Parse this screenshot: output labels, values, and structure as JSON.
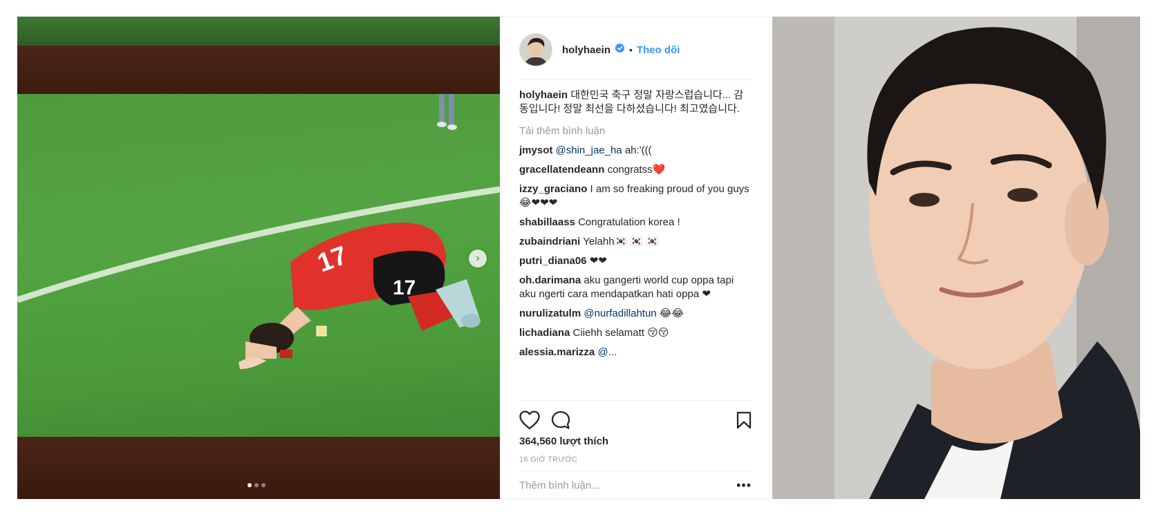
{
  "post": {
    "username": "holyhaein",
    "follow_label": "Theo dõi",
    "bullet": "•",
    "caption_user": "holyhaein",
    "caption_text": "대한민국 축구 정말 자랑스럽습니다... 감동입니다! 정말 최선을 다하셨습니다! 최고였습니다.",
    "load_more": "Tải thêm bình luận",
    "comments": [
      {
        "user": "jmysot",
        "mention": "@shin_jae_ha",
        "text": "ah:'((("
      },
      {
        "user": "gracellatendeann",
        "mention": "",
        "text": "congratss❤️"
      },
      {
        "user": "izzy_graciano",
        "mention": "",
        "text": "I am so freaking proud of you guys 😂❤❤❤"
      },
      {
        "user": "shabillaass",
        "mention": "",
        "text": "Congratulation korea !"
      },
      {
        "user": "zubaindriani",
        "mention": "",
        "text": "Yelahh🇰🇷 🇰🇷 🇰🇷"
      },
      {
        "user": "putri_diana06",
        "mention": "",
        "text": "❤❤"
      },
      {
        "user": "oh.darimana",
        "mention": "",
        "text": "aku gangerti world cup oppa tapi aku ngerti cara mendapatkan hati oppa ❤"
      },
      {
        "user": "nurulizatulm",
        "mention": "@nurfadillahtun",
        "text": "😂😂"
      },
      {
        "user": "lichadiana",
        "mention": "",
        "text": "Ciiehh selamatt 😚😚"
      },
      {
        "user": "alessia.marizza",
        "mention": "@...",
        "text": ""
      }
    ],
    "likes": "364,560 lượt thích",
    "time": "16 GIỜ TRƯỚC",
    "add_comment_placeholder": "Thêm bình luận...",
    "more": "•••"
  },
  "media": {
    "slide_count": 3,
    "active_slide": 1,
    "jersey_number": "17"
  },
  "colors": {
    "link": "#3897f0",
    "text": "#262626",
    "muted": "#999999",
    "border": "#efefef",
    "jersey": "#e0312b",
    "pitch": "#52a141"
  }
}
